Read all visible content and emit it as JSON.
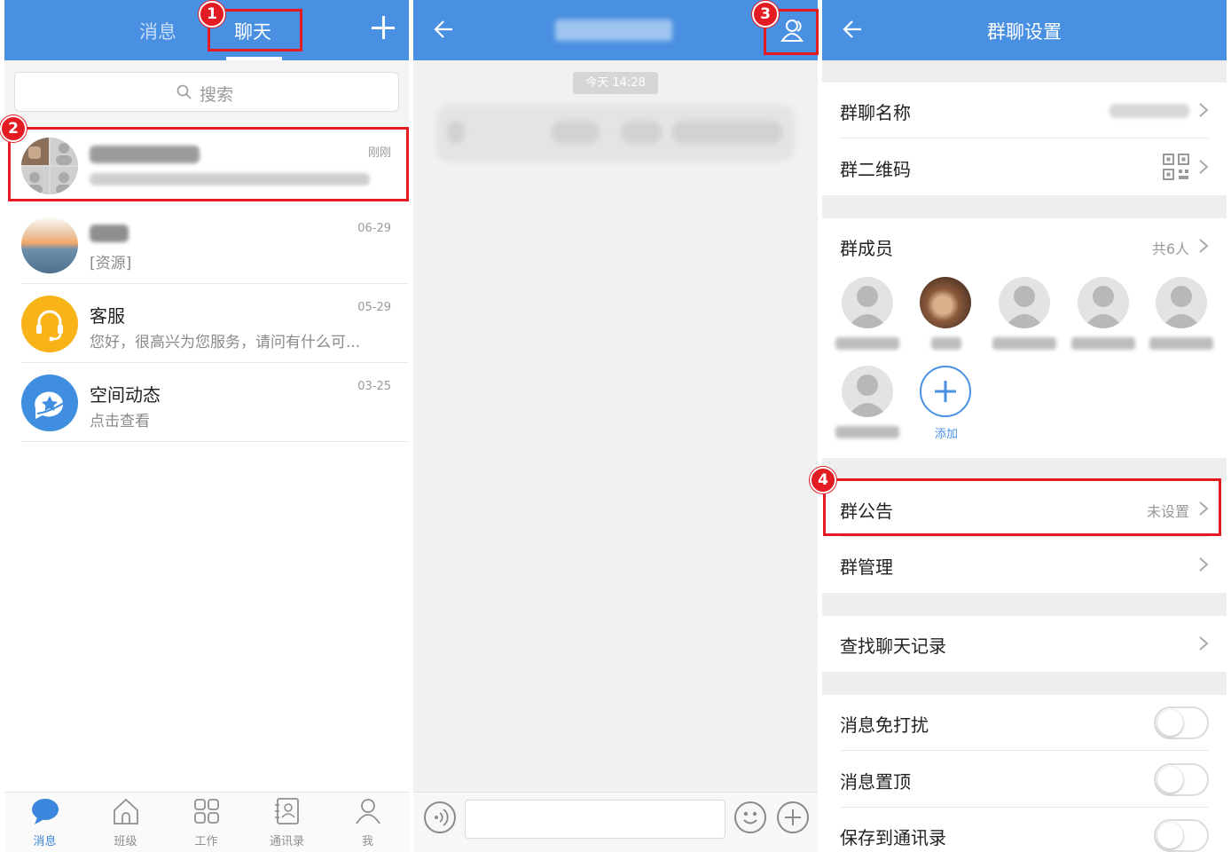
{
  "colors": {
    "topbar": "#4a90e2",
    "callout": "#e31b23",
    "active_tab": "#3c86dd"
  },
  "panel1": {
    "tabs": {
      "messages": "消息",
      "chat": "聊天"
    },
    "search": {
      "placeholder": "搜索"
    },
    "conversations": [
      {
        "name": "",
        "preview": "",
        "time": "刚刚",
        "avatar": "group-grid"
      },
      {
        "name": "",
        "preview": "[资源]",
        "time": "06-29",
        "avatar": "sunset-photo"
      },
      {
        "name": "客服",
        "preview": "您好，很高兴为您服务，请问有什么可...",
        "time": "05-29",
        "avatar": "headset-icon"
      },
      {
        "name": "空间动态",
        "preview": "点击查看",
        "time": "03-25",
        "avatar": "space-icon"
      }
    ],
    "tabbar": [
      {
        "label": "消息",
        "icon": "chat-bubble-icon",
        "active": true
      },
      {
        "label": "班级",
        "icon": "house-icon"
      },
      {
        "label": "工作",
        "icon": "grid-icon"
      },
      {
        "label": "通讯录",
        "icon": "contacts-icon"
      },
      {
        "label": "我",
        "icon": "person-icon"
      }
    ]
  },
  "panel2": {
    "timestamp": "今天 14:28"
  },
  "panel3": {
    "title": "群聊设置",
    "rows": {
      "group_name": {
        "label": "群聊名称"
      },
      "qrcode": {
        "label": "群二维码"
      },
      "members": {
        "label": "群成员",
        "value": "共6人"
      },
      "notice": {
        "label": "群公告",
        "value": "未设置"
      },
      "manage": {
        "label": "群管理"
      },
      "search_history": {
        "label": "查找聊天记录"
      },
      "mute": {
        "label": "消息免打扰",
        "on": false
      },
      "pin": {
        "label": "消息置顶",
        "on": false
      },
      "save_contacts": {
        "label": "保存到通讯录",
        "on": false
      }
    },
    "add_member_label": "添加"
  },
  "callouts": [
    "1",
    "2",
    "3",
    "4"
  ]
}
